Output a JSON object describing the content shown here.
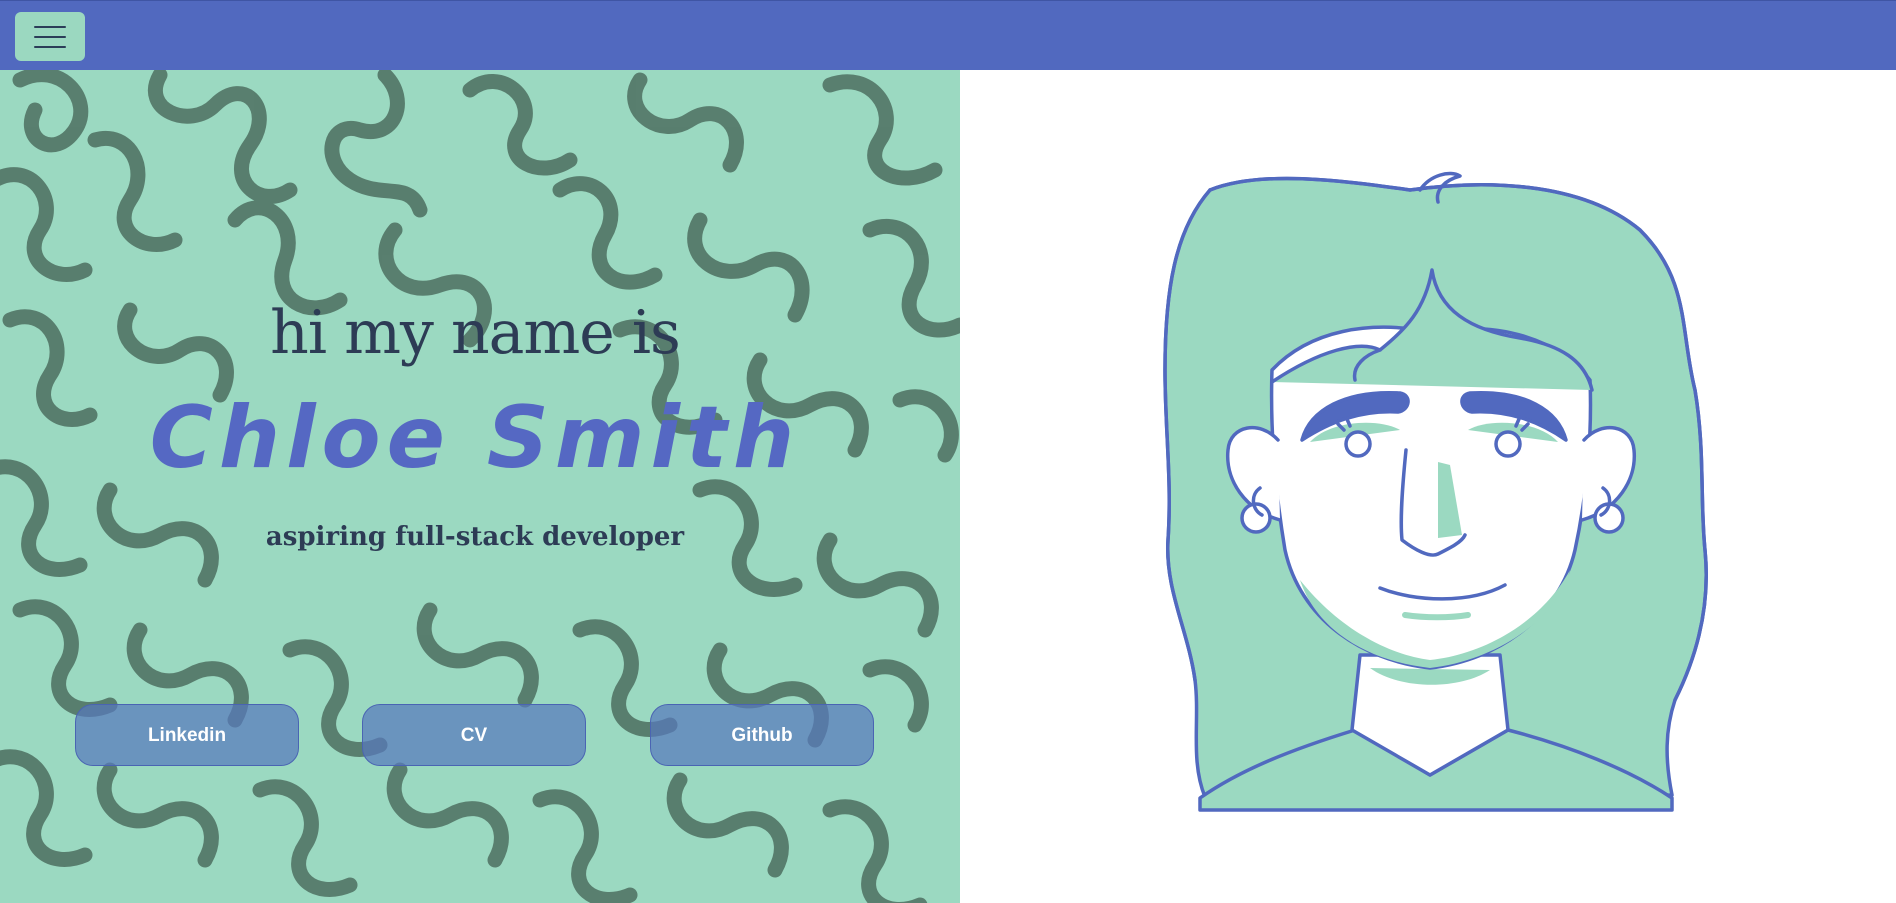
{
  "topbar": {
    "menu_icon": "hamburger-menu-icon",
    "color": "#5169bf"
  },
  "hero": {
    "greeting": "hi my name is",
    "name": "Chloe Smith",
    "tagline": "aspiring full-stack developer",
    "background_color": "#9bd9c1",
    "pattern": "squiggle-pattern"
  },
  "links": [
    {
      "label": "Linkedin"
    },
    {
      "label": "CV"
    },
    {
      "label": "Github"
    }
  ],
  "portrait": {
    "illustration": "woman-portrait-illustration",
    "line_color": "#5169bf",
    "fill_color": "#9bd9c1"
  },
  "colors": {
    "accent": "#5169bf",
    "mint": "#9bd9c1",
    "text_dark": "#2d3c55",
    "squiggle": "#557a6a"
  }
}
